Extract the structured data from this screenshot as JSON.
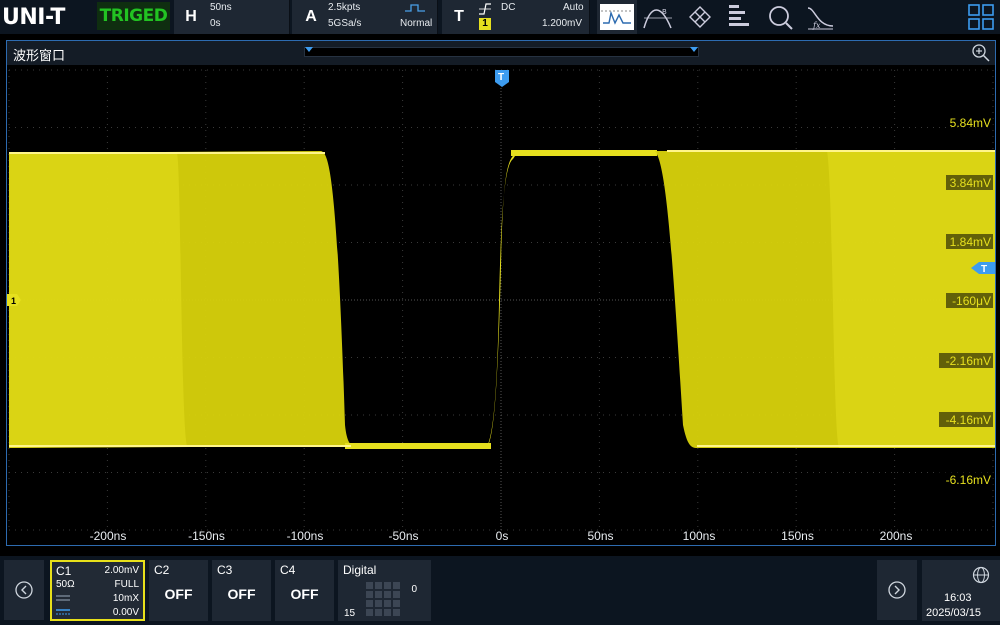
{
  "brand": "UNI-T",
  "status": "TRIGED",
  "horizontal": {
    "label": "H",
    "timebase": "50ns",
    "position": "0s"
  },
  "acquisition": {
    "label": "A",
    "depth": "2.5kpts",
    "sample_rate": "5GSa/s",
    "mode": "Normal"
  },
  "trigger": {
    "label": "T",
    "coupling": "DC",
    "sweep": "Auto",
    "source": "1",
    "level": "1.200mV"
  },
  "toolbar_icons": [
    "cursor-icon",
    "math-icon",
    "mask-icon",
    "measure-icon",
    "search-icon",
    "fft-icon"
  ],
  "wave_window": {
    "title": "波形窗口",
    "y_ticks": [
      "5.84mV",
      "3.84mV",
      "1.84mV",
      "-160μV",
      "-2.16mV",
      "-4.16mV",
      "-6.16mV"
    ],
    "x_ticks": [
      "-200ns",
      "-150ns",
      "-100ns",
      "-50ns",
      "0s",
      "50ns",
      "100ns",
      "150ns",
      "200ns"
    ],
    "channel_marker": "1",
    "trigger_marker": "T"
  },
  "channels": {
    "c1": {
      "label": "C1",
      "scale": "2.00mV",
      "impedance": "50Ω",
      "bandwidth": "FULL",
      "probe": "10mX",
      "offset": "0.00V"
    },
    "c2": {
      "label": "C2",
      "state": "OFF"
    },
    "c3": {
      "label": "C3",
      "state": "OFF"
    },
    "c4": {
      "label": "C4",
      "state": "OFF"
    },
    "digital": {
      "label": "Digital",
      "high": "0",
      "low": "15"
    }
  },
  "clock": {
    "time": "16:03",
    "date": "2025/03/15"
  },
  "colors": {
    "trace": "#e6e01e",
    "accent": "#2d6bb0",
    "status": "#22c322",
    "panel": "#1e2733"
  }
}
